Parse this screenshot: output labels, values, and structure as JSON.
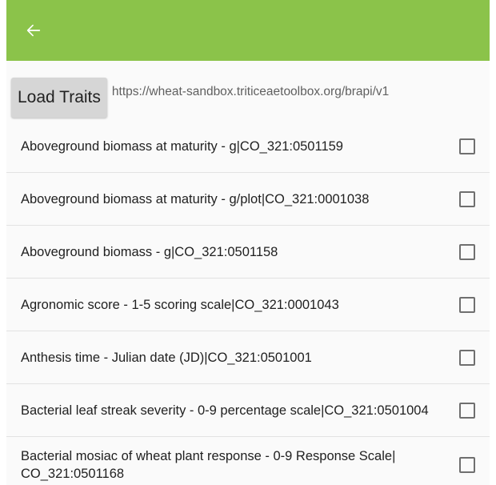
{
  "colors": {
    "appbar": "#8bc34a",
    "button_bg": "#d6d6d6"
  },
  "appbar": {
    "back_icon": "arrow-left-icon"
  },
  "toolbar": {
    "load_label": "Load Traits",
    "url": "https://wheat-sandbox.triticeaetoolbox.org/brapi/v1"
  },
  "traits": [
    {
      "label": "Aboveground biomass at maturity - g|CO_321:0501159",
      "checked": false
    },
    {
      "label": "Aboveground biomass at maturity - g/plot|CO_321:0001038",
      "checked": false
    },
    {
      "label": "Aboveground biomass - g|CO_321:0501158",
      "checked": false
    },
    {
      "label": "Agronomic score - 1-5 scoring scale|CO_321:0001043",
      "checked": false
    },
    {
      "label": "Anthesis time - Julian date (JD)|CO_321:0501001",
      "checked": false
    },
    {
      "label": "Bacterial leaf streak severity - 0-9 percentage scale|CO_321:0501004",
      "checked": false
    },
    {
      "label": "Bacterial mosiac of wheat plant response - 0-9 Response Scale| CO_321:0501168",
      "checked": false
    }
  ]
}
